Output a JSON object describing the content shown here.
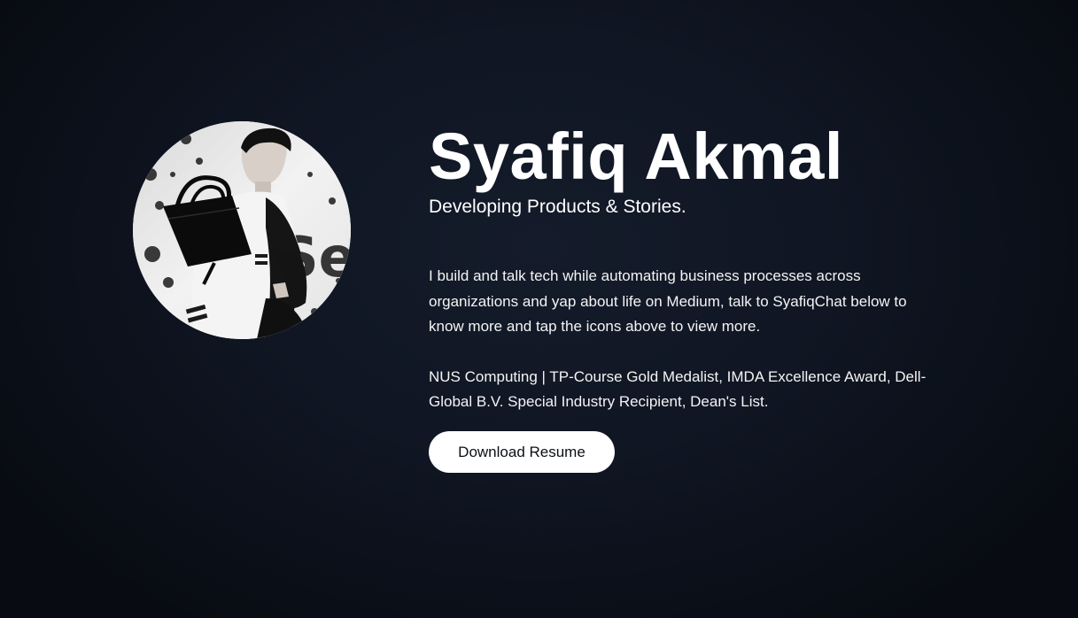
{
  "profile": {
    "name": "Syafiq Akmal",
    "tagline": "Developing Products & Stories.",
    "bio": "I build and talk tech while automating business processes across organizations and yap about life on Medium, talk to SyafiqChat below to know more and tap the icons above to view more.",
    "credentials": "NUS Computing | TP-Course Gold Medalist, IMDA Excellence Award, Dell-Global B.V. Special Industry Recipient, Dean's List.",
    "resume_label": "Download Resume",
    "photo_text": "Sei"
  },
  "colors": {
    "background": "#101623",
    "text": "#ffffff",
    "button_background": "#ffffff",
    "button_text": "#0b0f16"
  }
}
